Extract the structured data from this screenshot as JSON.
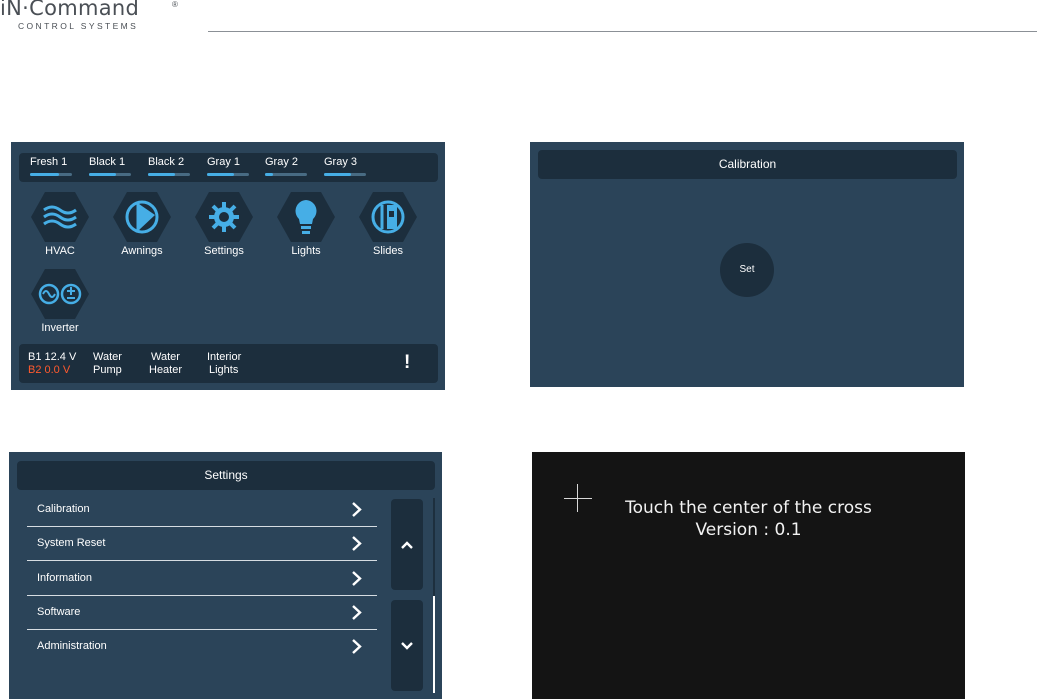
{
  "brand": {
    "name": "iN·Command",
    "reg_mark": "®",
    "tagline": "CONTROL SYSTEMS"
  },
  "home_screen": {
    "tanks": [
      {
        "label": "Fresh 1",
        "level": 0.7
      },
      {
        "label": "Black 1",
        "level": 0.65
      },
      {
        "label": "Black 2",
        "level": 0.65
      },
      {
        "label": "Gray 1",
        "level": 0.65
      },
      {
        "label": "Gray 2",
        "level": 0.2
      },
      {
        "label": "Gray 3",
        "level": 0.65
      }
    ],
    "tiles": [
      {
        "label": "HVAC",
        "icon": "hvac-waves-icon"
      },
      {
        "label": "Awnings",
        "icon": "awning-icon"
      },
      {
        "label": "Settings",
        "icon": "gear-icon"
      },
      {
        "label": "Lights",
        "icon": "lightbulb-icon"
      },
      {
        "label": "Slides",
        "icon": "slide-room-icon"
      },
      {
        "label": "Inverter",
        "icon": "inverter-icon"
      }
    ],
    "status": {
      "b1": "B1 12.4 V",
      "b2": "B2  0.0 V",
      "water_pump_line1": "Water",
      "water_pump_line2": "Pump",
      "water_heater_line1": "Water",
      "water_heater_line2": "Heater",
      "interior_lights_line1": "Interior",
      "interior_lights_line2": "Lights",
      "alert": "!"
    }
  },
  "calibration_screen": {
    "title": "Calibration",
    "set_label": "Set"
  },
  "settings_screen": {
    "title": "Settings",
    "items": [
      {
        "label": "Calibration"
      },
      {
        "label": "System Reset"
      },
      {
        "label": "Information"
      },
      {
        "label": "Software"
      },
      {
        "label": "Administration"
      }
    ],
    "scroll_up_icon": "chevron-up-icon",
    "scroll_down_icon": "chevron-down-icon",
    "scroll_position": 0.5
  },
  "touch_calibration_screen": {
    "instruction": "Touch the center of the cross",
    "version": "Version : 0.1"
  },
  "colors": {
    "panel_bg": "#2b4459",
    "bar_bg": "#1c2e3d",
    "accent_blue": "#46aee6",
    "warning_red": "#ff5a2e",
    "touch_bg": "#141414"
  }
}
